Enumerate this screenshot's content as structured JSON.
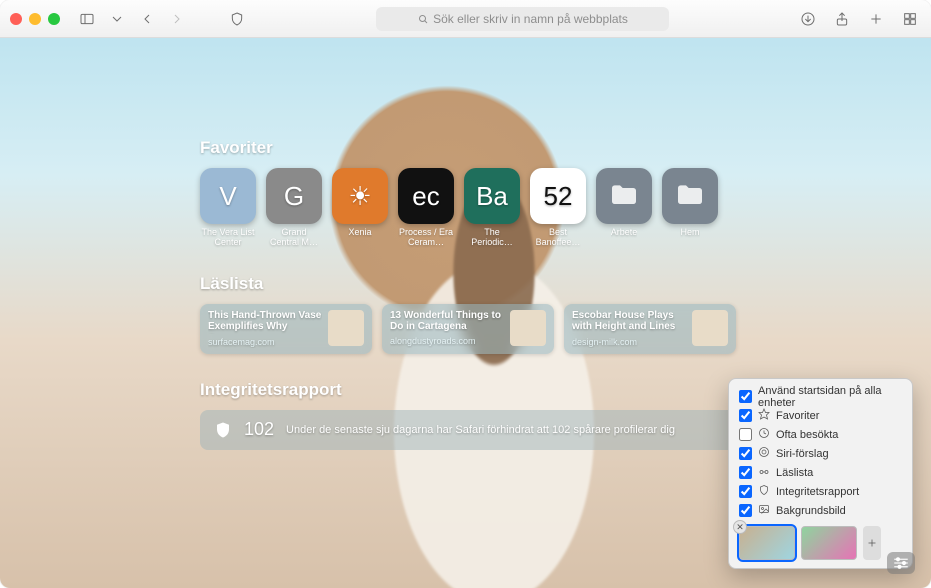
{
  "toolbar": {
    "search_placeholder": "Sök eller skriv in namn på webbplats"
  },
  "sections": {
    "favorites_title": "Favoriter",
    "readinglist_title": "Läslista",
    "privacy_title": "Integritetsrapport"
  },
  "favorites": [
    {
      "label": "The Vera List Center",
      "glyph": "V",
      "bg": "#9bb9d4"
    },
    {
      "label": "Grand Central M…",
      "glyph": "G",
      "bg": "#8a8a8a"
    },
    {
      "label": "Xenia",
      "glyph": "☀",
      "bg": "#e07a2c"
    },
    {
      "label": "Process / Era Ceram…",
      "glyph": "ec",
      "bg": "#111111"
    },
    {
      "label": "The Periodic…",
      "glyph": "Ba",
      "bg": "#1f6f5c"
    },
    {
      "label": "Best Banoffee…",
      "glyph": "52",
      "bg": "#ffffff",
      "fg": "#111"
    },
    {
      "label": "Arbete",
      "folder": true,
      "bg": "#7a8590"
    },
    {
      "label": "Hem",
      "folder": true,
      "bg": "#7a8590"
    }
  ],
  "readinglist": [
    {
      "title": "This Hand-Thrown Vase Exemplifies Why Ceras…",
      "domain": "surfacemag.com"
    },
    {
      "title": "13 Wonderful Things to Do in Cartagena",
      "domain": "alongdustyroads.com"
    },
    {
      "title": "Escobar House Plays with Height and Lines t…",
      "domain": "design-milk.com"
    }
  ],
  "privacy": {
    "count": "102",
    "text": "Under de senaste sju dagarna har Safari förhindrat att 102 spårare profilerar dig"
  },
  "popover": {
    "sync": "Använd startsidan på alla enheter",
    "items": [
      {
        "label": "Favoriter",
        "checked": true,
        "icon": "star"
      },
      {
        "label": "Ofta besökta",
        "checked": false,
        "icon": "clock"
      },
      {
        "label": "Siri-förslag",
        "checked": true,
        "icon": "siri"
      },
      {
        "label": "Läslista",
        "checked": true,
        "icon": "glasses"
      },
      {
        "label": "Integritetsrapport",
        "checked": true,
        "icon": "shield"
      },
      {
        "label": "Bakgrundsbild",
        "checked": true,
        "icon": "image"
      }
    ]
  }
}
